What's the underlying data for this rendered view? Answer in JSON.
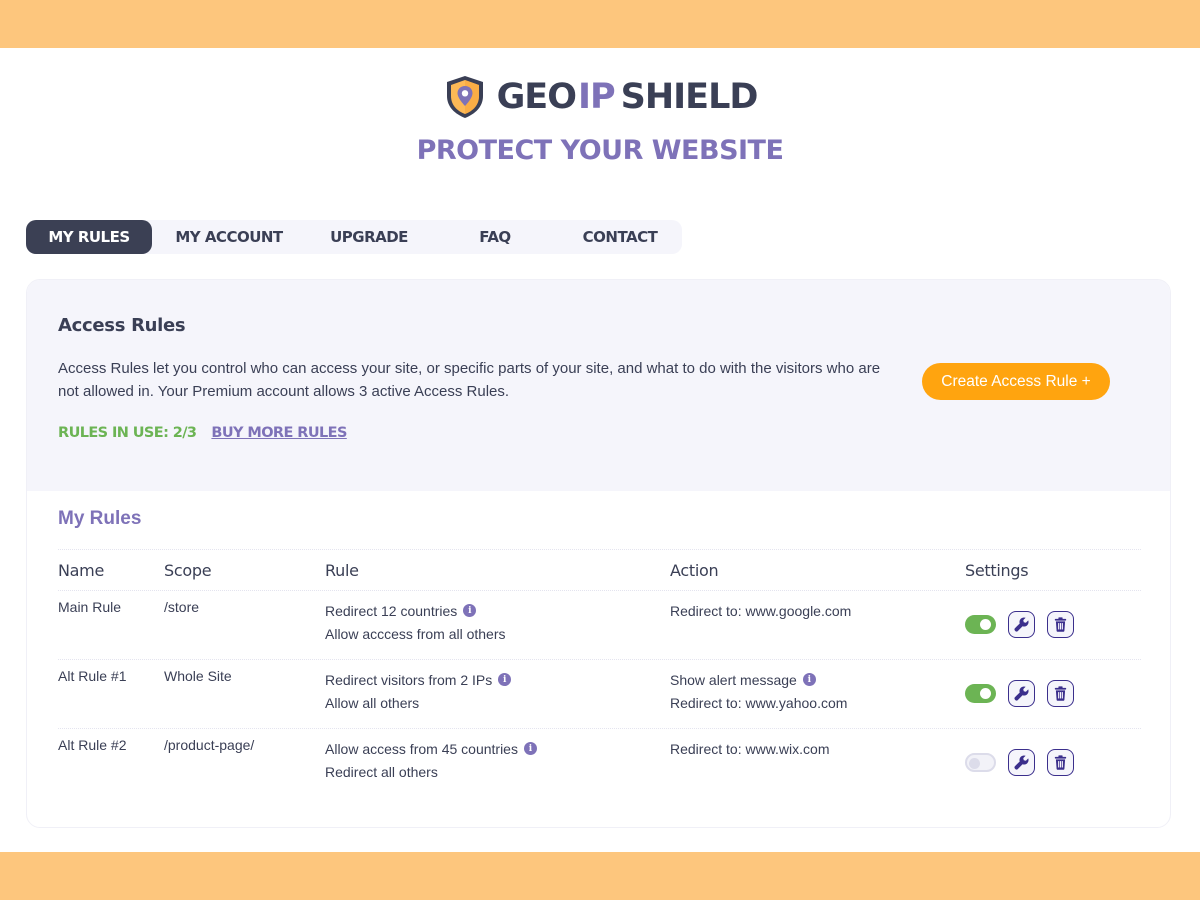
{
  "brand": {
    "name_part1": "GEO",
    "name_part2": "IP",
    "name_part3": "SHIELD",
    "tagline": "PROTECT YOUR WEBSITE",
    "logo_icon": "shield-location-pin-icon"
  },
  "colors": {
    "accent_purple": "#7e72b8",
    "dark": "#3a3f55",
    "orange_button": "#ffa40f",
    "band_orange": "#fdc67d",
    "green": "#6cb454"
  },
  "tabs": [
    {
      "label": "MY RULES",
      "active": true
    },
    {
      "label": "MY ACCOUNT",
      "active": false
    },
    {
      "label": "UPGRADE",
      "active": false
    },
    {
      "label": "FAQ",
      "active": false
    },
    {
      "label": "CONTACT",
      "active": false
    }
  ],
  "access_rules": {
    "title": "Access Rules",
    "description": "Access Rules let you control who can access your site, or specific parts of your site, and what to do with the visitors who are not allowed in. Your Premium account allows 3 active Access Rules.",
    "usage_label": "RULES IN USE: 2/3",
    "buy_more_label": "BUY MORE RULES",
    "create_button_label": "Create Access Rule +"
  },
  "my_rules": {
    "title": "My Rules",
    "columns": [
      "Name",
      "Scope",
      "Rule",
      "Action",
      "Settings"
    ],
    "rows": [
      {
        "name": "Main Rule",
        "scope": "/store",
        "rule_lines": [
          "Redirect 12 countries",
          "Allow acccess from all others"
        ],
        "rule_info": true,
        "action_lines": [
          "Redirect to: www.google.com"
        ],
        "action_info": false,
        "enabled": true
      },
      {
        "name": "Alt Rule #1",
        "scope": "Whole Site",
        "rule_lines": [
          "Redirect visitors from 2 IPs",
          "Allow all others"
        ],
        "rule_info": true,
        "action_lines": [
          "Show alert message",
          "Redirect to: www.yahoo.com"
        ],
        "action_info": true,
        "enabled": true
      },
      {
        "name": "Alt Rule #2",
        "scope": "/product-page/",
        "rule_lines": [
          "Allow access from 45 countries",
          "Redirect all others"
        ],
        "rule_info": true,
        "action_lines": [
          "Redirect to: www.wix.com"
        ],
        "action_info": false,
        "enabled": false
      }
    ],
    "info_glyph": "i",
    "edit_icon": "wrench-icon",
    "delete_icon": "trash-icon"
  }
}
